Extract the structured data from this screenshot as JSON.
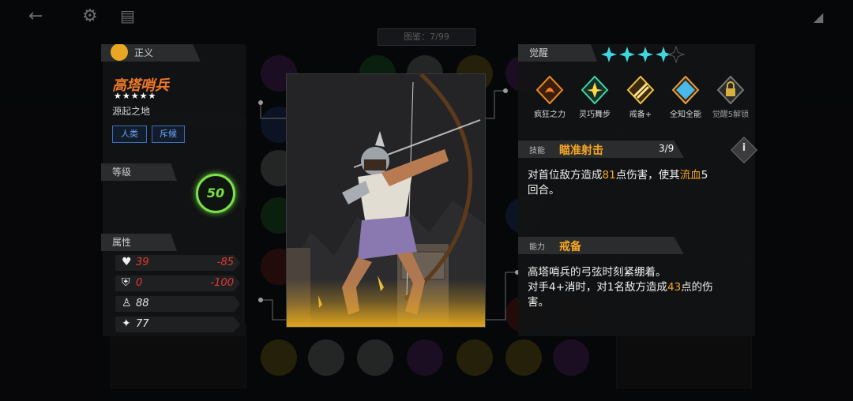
{
  "window": {
    "counter_text": "图鉴：7/99"
  },
  "hero": {
    "faction": "正义",
    "name": "高塔哨兵",
    "stars": "★★★★★",
    "origin": "源起之地",
    "tags": [
      "人类",
      "斥候"
    ]
  },
  "level": {
    "label": "等级",
    "value": "50"
  },
  "attributes": {
    "label": "属性",
    "rows": [
      {
        "icon": "heart-icon",
        "value": "39",
        "delta": "-85",
        "value_color": "#e23b2e"
      },
      {
        "icon": "shield-icon",
        "value": "0",
        "delta": "-100",
        "value_color": "#e23b2e"
      },
      {
        "icon": "strength-icon",
        "value": "88",
        "delta": "",
        "value_color": "#eaeaea"
      },
      {
        "icon": "agility-icon",
        "value": "77",
        "delta": "",
        "value_color": "#eaeaea"
      }
    ]
  },
  "awakening": {
    "label": "觉醒",
    "stars_filled": 4,
    "stars_total": 5,
    "skills": [
      {
        "label": "疯狂之力",
        "icon": "rage-icon"
      },
      {
        "label": "灵巧舞步",
        "icon": "dance-icon"
      },
      {
        "label": "戒备+",
        "icon": "guard-icon"
      },
      {
        "label": "全知全能",
        "icon": "omniscience-icon"
      },
      {
        "label": "觉醒5解锁",
        "icon": "lock-icon"
      }
    ]
  },
  "skill": {
    "type_label": "技能",
    "name": "瞄准射击",
    "count": "3/9",
    "desc_parts": [
      "对首位敌方造成",
      "81",
      "点伤害，使其",
      "流血",
      "5",
      "回合。"
    ]
  },
  "ability": {
    "type_label": "能力",
    "name": "戒备",
    "desc_line1": "高塔哨兵的弓弦时刻紧绷着。",
    "desc_parts": [
      "对手4+消时，对1名敌方造成",
      "43",
      "点的伤",
      "害。"
    ]
  },
  "colors": {
    "accent_orange": "#f5a623",
    "hero_name": "#f0782a",
    "chip_blue": "#3b6fb8",
    "level_green": "#7ce14b",
    "awaken_star": "#3fd6e0"
  }
}
